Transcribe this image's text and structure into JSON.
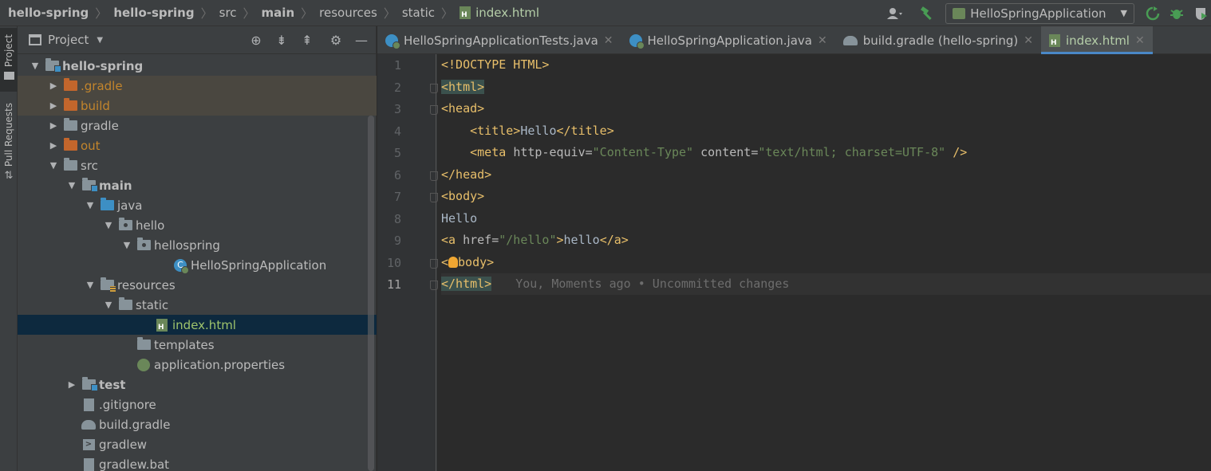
{
  "breadcrumb": [
    {
      "label": "hello-spring",
      "bold": true
    },
    {
      "label": "hello-spring",
      "bold": true
    },
    {
      "label": "src",
      "bold": false
    },
    {
      "label": "main",
      "bold": true
    },
    {
      "label": "resources",
      "bold": false
    },
    {
      "label": "static",
      "bold": false
    },
    {
      "label": "index.html",
      "bold": false
    }
  ],
  "toolbar": {
    "run_config": "HelloSpringApplication",
    "icons": [
      "user-icon",
      "hammer-icon",
      "rerun-icon",
      "debug-icon",
      "coverage-icon"
    ]
  },
  "stripe": {
    "project": "Project",
    "pull_requests": "Pull Requests"
  },
  "panel": {
    "title": "Project",
    "tools": [
      "locate-icon",
      "expand-all-icon",
      "collapse-all-icon",
      "gear-icon",
      "minimize-icon"
    ]
  },
  "tree": [
    {
      "label": "hello-spring",
      "depth": 1,
      "arrow": "down",
      "icon": "module-folder",
      "style": "bold"
    },
    {
      "label": ".gradle",
      "depth": 2,
      "arrow": "right",
      "icon": "folder-orange",
      "style": "orange",
      "excluded": true
    },
    {
      "label": "build",
      "depth": 2,
      "arrow": "right",
      "icon": "folder-orange",
      "style": "orange",
      "excluded": true
    },
    {
      "label": "gradle",
      "depth": 2,
      "arrow": "right",
      "icon": "folder",
      "style": ""
    },
    {
      "label": "out",
      "depth": 2,
      "arrow": "right",
      "icon": "folder-orange",
      "style": "orange"
    },
    {
      "label": "src",
      "depth": 2,
      "arrow": "down",
      "icon": "folder",
      "style": ""
    },
    {
      "label": "main",
      "depth": 3,
      "arrow": "down",
      "icon": "module-folder",
      "style": "bold"
    },
    {
      "label": "java",
      "depth": 4,
      "arrow": "down",
      "icon": "folder-blue",
      "style": ""
    },
    {
      "label": "hello",
      "depth": 5,
      "arrow": "down",
      "icon": "package",
      "style": ""
    },
    {
      "label": "hellospring",
      "depth": 6,
      "arrow": "down",
      "icon": "package",
      "style": ""
    },
    {
      "label": "HelloSpringApplication",
      "depth": 8,
      "arrow": "",
      "icon": "java-class",
      "style": ""
    },
    {
      "label": "resources",
      "depth": 4,
      "arrow": "down",
      "icon": "resources-folder",
      "style": ""
    },
    {
      "label": "static",
      "depth": 5,
      "arrow": "down",
      "icon": "folder",
      "style": ""
    },
    {
      "label": "index.html",
      "depth": 7,
      "arrow": "",
      "icon": "html-file",
      "style": "green",
      "selected": true
    },
    {
      "label": "templates",
      "depth": 6,
      "arrow": "",
      "icon": "folder",
      "style": ""
    },
    {
      "label": "application.properties",
      "depth": 6,
      "arrow": "",
      "icon": "properties-file",
      "style": ""
    },
    {
      "label": "test",
      "depth": 3,
      "arrow": "right",
      "icon": "module-folder",
      "style": "bold"
    },
    {
      "label": ".gitignore",
      "depth": 3,
      "arrow": "",
      "icon": "git-file",
      "style": ""
    },
    {
      "label": "build.gradle",
      "depth": 3,
      "arrow": "",
      "icon": "gradle-file",
      "style": ""
    },
    {
      "label": "gradlew",
      "depth": 3,
      "arrow": "",
      "icon": "shell-file",
      "style": ""
    },
    {
      "label": "gradlew.bat",
      "depth": 3,
      "arrow": "",
      "icon": "bat-file",
      "style": ""
    }
  ],
  "tabs": [
    {
      "label": "HelloSpringApplicationTests.java",
      "icon": "java-test-icon",
      "active": false
    },
    {
      "label": "HelloSpringApplication.java",
      "icon": "java-class-icon",
      "active": false
    },
    {
      "label": "build.gradle (hello-spring)",
      "icon": "gradle-icon",
      "active": false
    },
    {
      "label": "index.html",
      "icon": "html-icon",
      "active": true
    }
  ],
  "editor": {
    "current_line": 11,
    "blame": "You, Moments ago • Uncommitted changes",
    "lines": [
      [
        {
          "t": "<!DOCTYPE HTML>",
          "c": "tag"
        }
      ],
      [
        {
          "t": "<html>",
          "c": "tag match"
        }
      ],
      [
        {
          "t": "<head>",
          "c": "tag"
        }
      ],
      [
        {
          "t": "    ",
          "c": "txt"
        },
        {
          "t": "<title>",
          "c": "tag"
        },
        {
          "t": "Hello",
          "c": "txt"
        },
        {
          "t": "</title>",
          "c": "tag"
        }
      ],
      [
        {
          "t": "    ",
          "c": "txt"
        },
        {
          "t": "<meta ",
          "c": "tag"
        },
        {
          "t": "http-equiv=",
          "c": "attr"
        },
        {
          "t": "\"Content-Type\"",
          "c": "str"
        },
        {
          "t": " content=",
          "c": "attr"
        },
        {
          "t": "\"text/html; charset=UTF-8\"",
          "c": "str"
        },
        {
          "t": " />",
          "c": "tag"
        }
      ],
      [
        {
          "t": "</head>",
          "c": "tag"
        }
      ],
      [
        {
          "t": "<body>",
          "c": "tag"
        }
      ],
      [
        {
          "t": "Hello",
          "c": "txt"
        }
      ],
      [
        {
          "t": "<a ",
          "c": "tag"
        },
        {
          "t": "href=",
          "c": "attr"
        },
        {
          "t": "\"/hello\"",
          "c": "str"
        },
        {
          "t": ">",
          "c": "tag"
        },
        {
          "t": "hello",
          "c": "txt"
        },
        {
          "t": "</a>",
          "c": "tag"
        }
      ],
      [
        {
          "t": "<",
          "c": "tag"
        },
        {
          "t": "BULB",
          "c": "bulb"
        },
        {
          "t": "body>",
          "c": "tag"
        }
      ],
      [
        {
          "t": "</html>",
          "c": "tag match"
        }
      ]
    ],
    "fold_lines": [
      2,
      3,
      6,
      7,
      10,
      11
    ]
  }
}
